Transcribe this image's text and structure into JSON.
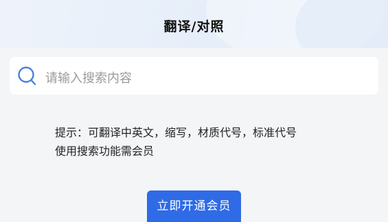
{
  "header": {
    "title": "翻译/对照"
  },
  "search": {
    "icon": "search-icon",
    "placeholder": "请输入搜索内容"
  },
  "hint": {
    "line1": "提示：可翻译中英文，缩写，材质代号，标准代号",
    "line2": "使用搜索功能需会员"
  },
  "cta": {
    "label": "立即开通会员"
  },
  "colors": {
    "accent": "#2f6be6",
    "page_background": "#f4f5f7",
    "search_icon": "#4a7fe0"
  }
}
